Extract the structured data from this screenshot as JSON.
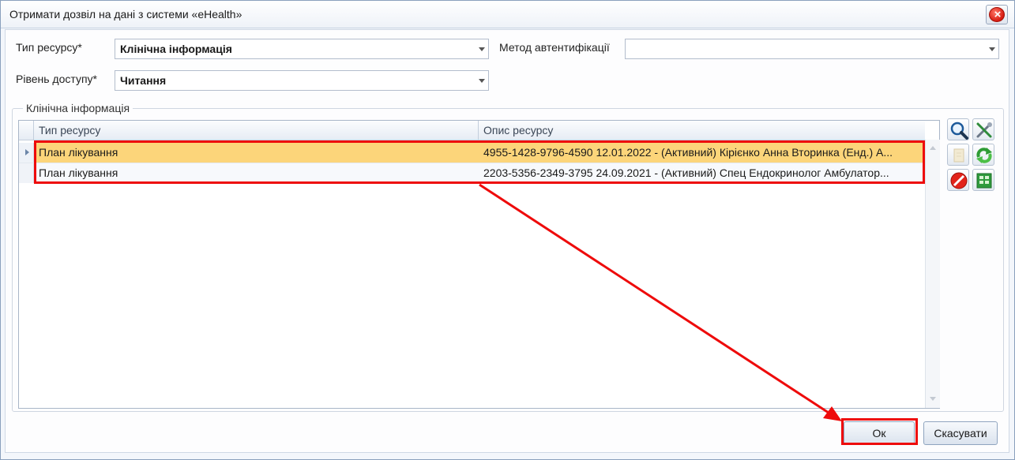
{
  "window": {
    "title": "Отримати дозвіл на дані з системи «eHealth»"
  },
  "form": {
    "resource_type_label": "Тип ресурсу*",
    "resource_type_value": "Клінічна інформація",
    "auth_method_label": "Метод автентифікації",
    "auth_method_value": "",
    "access_level_label": "Рівень доступу*",
    "access_level_value": "Читання"
  },
  "group": {
    "title": "Клінічна інформація"
  },
  "grid": {
    "columns": [
      "Тип ресурсу",
      "Опис ресурсу"
    ],
    "rows": [
      {
        "type": "План лікування",
        "description": "4955-1428-9796-4590 12.01.2022 -  (Активний) Кірієнко Анна Вторинка (Енд.) А..."
      },
      {
        "type": "План лікування",
        "description": "2203-5356-2349-3795 24.09.2021 -  (Активний) Спец Ендокринолог Амбулатор..."
      }
    ]
  },
  "toolbar": {
    "icons": [
      "search-icon",
      "tools-icon",
      "document-icon",
      "refresh-icon",
      "delete-icon",
      "export-icon"
    ]
  },
  "buttons": {
    "ok": "Ок",
    "cancel": "Скасувати"
  },
  "colors": {
    "selected_row": "#fcd57a",
    "highlight": "#ee0b0b"
  }
}
